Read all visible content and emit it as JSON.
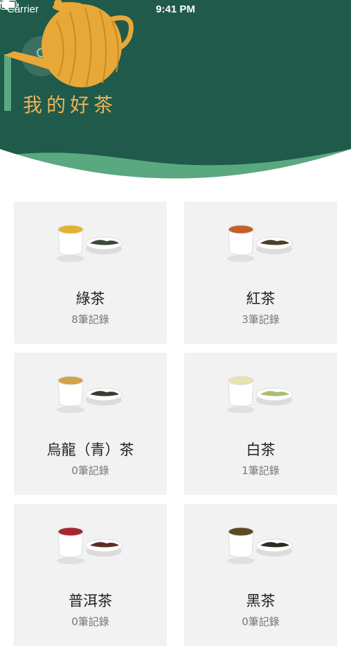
{
  "status_bar": {
    "carrier": "Carrier",
    "time": "9:41 PM"
  },
  "header": {
    "title": "我的好茶",
    "avatar_icon": "user-icon",
    "bg_color": "#1f5a4a",
    "title_color": "#e8b45a"
  },
  "categories": [
    {
      "name": "綠茶",
      "count": "8筆記錄",
      "liquor_color": "#e3b42b",
      "leaf_color": "#3d4a3a"
    },
    {
      "name": "紅茶",
      "count": "3筆記錄",
      "liquor_color": "#c4602a",
      "leaf_color": "#4b3f2a"
    },
    {
      "name": "烏龍（青）茶",
      "count": "0筆記錄",
      "liquor_color": "#d4a24a",
      "leaf_color": "#3a3c30"
    },
    {
      "name": "白茶",
      "count": "1筆記錄",
      "liquor_color": "#e6e3b0",
      "leaf_color": "#a8c070"
    },
    {
      "name": "普洱茶",
      "count": "0筆記錄",
      "liquor_color": "#a8262e",
      "leaf_color": "#5a2e22"
    },
    {
      "name": "黑茶",
      "count": "0筆記錄",
      "liquor_color": "#5b4a24",
      "leaf_color": "#2e2a22"
    }
  ]
}
